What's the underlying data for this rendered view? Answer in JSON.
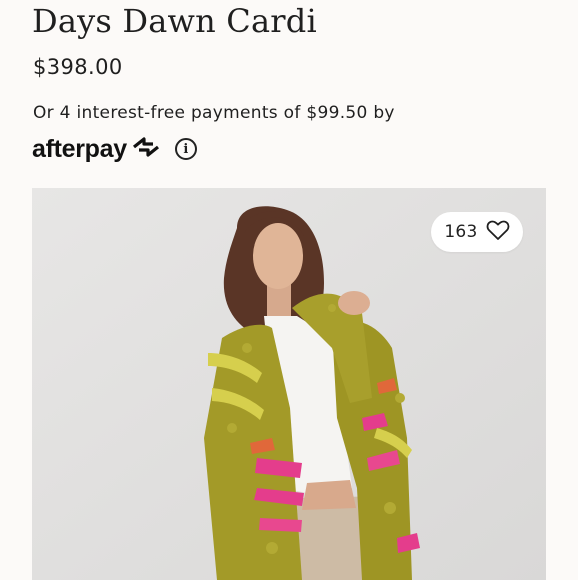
{
  "product": {
    "title": "Days Dawn Cardi",
    "price": "$398.00",
    "installment_text": "Or 4 interest-free payments of $99.50 by",
    "payment_provider": "afterpay",
    "likes": "163"
  },
  "icons": {
    "afterpay_mark": "afterpay-arrows-icon",
    "info": "info-icon",
    "heart": "heart-icon"
  },
  "colors": {
    "background": "#fcfaf8",
    "image_background": "#e1e0df",
    "cardigan_olive": "#a39a28",
    "stripe_pink": "#e43d8c"
  }
}
